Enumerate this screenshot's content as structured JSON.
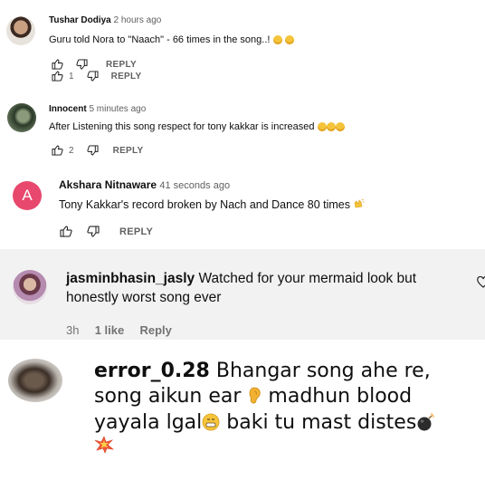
{
  "comments": [
    {
      "author": "Tushar Dodiya",
      "time": "2 hours ago",
      "text": "Guru told Nora to \"Naach\" - 66 times in the song..!",
      "emojis": [
        "smiling-face",
        "grinning-face"
      ],
      "reply_label_top": "REPLY",
      "like_count": "1",
      "reply_label": "REPLY"
    },
    {
      "author": "Innocent",
      "time": "5 minutes ago",
      "text": "After Listening this song respect for tony kakkar is increased",
      "emojis": [
        "grinning-face",
        "grinning-face",
        "grinning-face"
      ],
      "like_count": "2",
      "reply_label": "REPLY"
    },
    {
      "author": "Akshara Nitnaware",
      "avatar_letter": "A",
      "avatar_color": "#e8486d",
      "time": "41 seconds ago",
      "text": "Tony Kakkar's record broken by Nach and Dance 80 times",
      "emojis": [
        "clapping-hands"
      ],
      "reply_label": "REPLY"
    },
    {
      "author": "jasminbhasin_jasly",
      "text_line1": "Watched for your mermaid look but",
      "text_line2": "honestly worst song ever",
      "time": "3h",
      "likes": "1 like",
      "reply_label": "Reply"
    },
    {
      "author": "error_0.28",
      "text_line1": "Bhangar song ahe re,",
      "text_line2a": "song aikun ear",
      "text_line2b": "madhun blood",
      "text_line3a": "yayala lgal",
      "text_line3b": "baki tu mast distes",
      "emojis": [
        "ear",
        "grimacing-face",
        "bomb",
        "collision"
      ]
    }
  ]
}
